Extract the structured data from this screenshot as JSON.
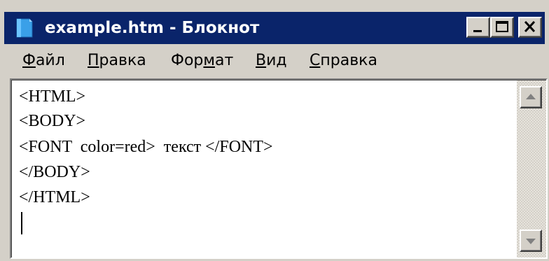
{
  "window": {
    "title": "example.htm - Блокнот",
    "app_icon": "notepad-icon",
    "buttons": {
      "minimize_icon": "minimize-icon",
      "maximize_icon": "maximize-icon",
      "close_icon": "close-icon"
    },
    "colors": {
      "titlebar": "#0a246a",
      "chrome": "#d4d0c8",
      "editor_bg": "#ffffff"
    }
  },
  "menu": {
    "items": [
      {
        "label_u": "Ф",
        "label_rest": "айл"
      },
      {
        "label_u": "П",
        "label_rest": "равка"
      },
      {
        "label_pre": "Фор",
        "label_u": "м",
        "label_rest": "ат"
      },
      {
        "label_u": "В",
        "label_rest": "ид"
      },
      {
        "label_u": "С",
        "label_rest": "правка"
      }
    ]
  },
  "editor": {
    "lines": [
      "<HTML>",
      "<BODY>",
      "<FONT  color=red>  текст </FONT>",
      "</BODY>",
      "</HTML>"
    ]
  },
  "scrollbar": {
    "up_icon": "scroll-up-arrow-icon",
    "down_icon": "scroll-down-arrow-icon"
  }
}
